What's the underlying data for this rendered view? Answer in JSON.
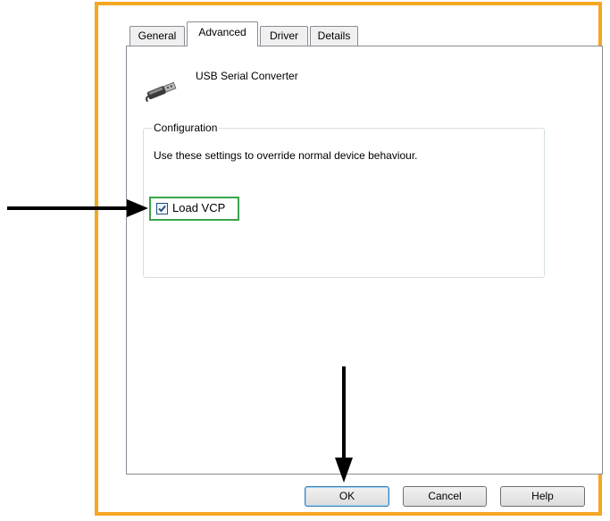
{
  "tabs": [
    {
      "label": "General"
    },
    {
      "label": "Advanced"
    },
    {
      "label": "Driver"
    },
    {
      "label": "Details"
    }
  ],
  "active_tab": "Advanced",
  "device": {
    "name": "USB Serial Converter",
    "icon": "usb-plug-icon"
  },
  "configuration": {
    "title": "Configuration",
    "description": "Use these settings to override normal device behaviour.",
    "load_vcp": {
      "label": "Load VCP",
      "checked": true
    }
  },
  "buttons": {
    "ok": "OK",
    "cancel": "Cancel",
    "help": "Help"
  },
  "colors": {
    "frame_border": "#f5a623",
    "highlight_border": "#3aa34a",
    "annotation_arrow": "#000000"
  }
}
